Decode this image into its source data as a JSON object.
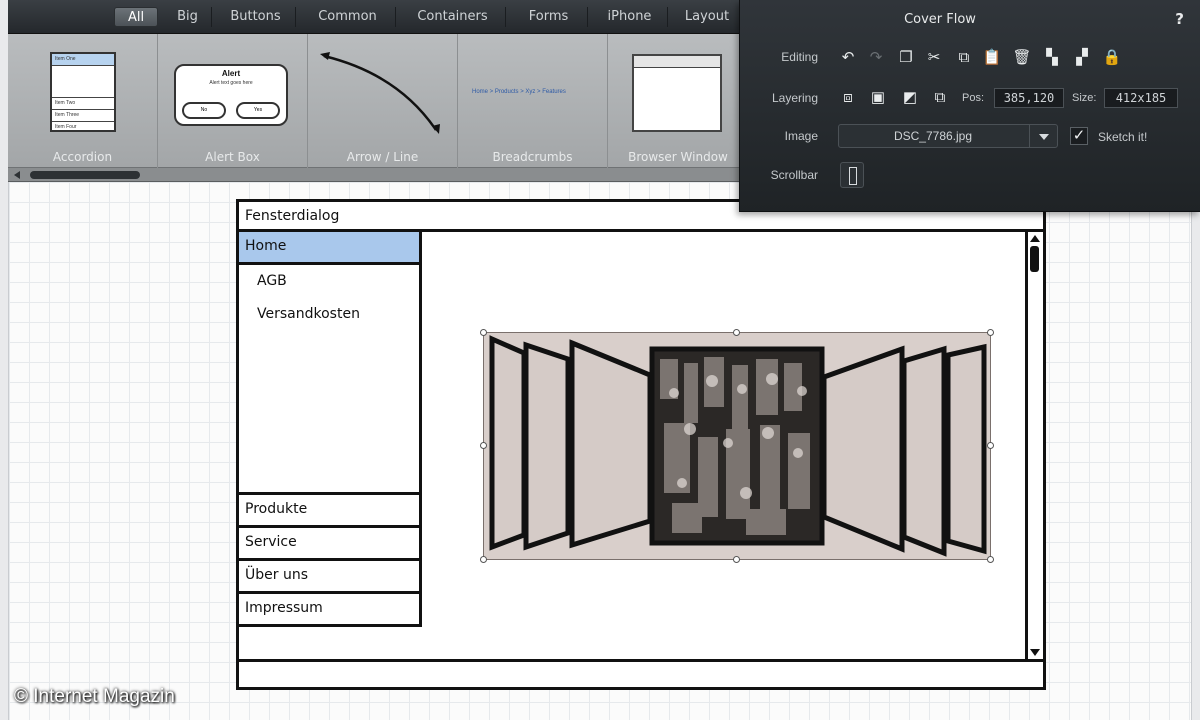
{
  "categories": {
    "tabs": [
      {
        "label": "All",
        "active": true
      },
      {
        "label": "Big"
      },
      {
        "label": "Buttons"
      },
      {
        "label": "Common"
      },
      {
        "label": "Containers"
      },
      {
        "label": "Forms"
      },
      {
        "label": "iPhone"
      },
      {
        "label": "Layout"
      }
    ]
  },
  "library": {
    "items": [
      {
        "label": "Accordion"
      },
      {
        "label": "Alert Box"
      },
      {
        "label": "Arrow / Line"
      },
      {
        "label": "Breadcrumbs"
      },
      {
        "label": "Browser Window"
      }
    ],
    "accordion_preview": [
      "Item One",
      "Item Two",
      "Item Three",
      "Item Four"
    ],
    "alert_preview": {
      "title": "Alert",
      "text": "Alert text goes here",
      "btn_no": "No",
      "btn_yes": "Yes"
    },
    "breadcrumb_preview": "Home > Products > Xyz > Features"
  },
  "inspector": {
    "title": "Cover Flow",
    "help": "?",
    "labels": {
      "editing": "Editing",
      "layering": "Layering",
      "image": "Image",
      "scrollbar": "Scrollbar"
    },
    "pos_label": "Pos:",
    "pos_value": "385,120",
    "size_label": "Size:",
    "size_value": "412x185",
    "image_file": "DSC_7786.jpg",
    "sketch_label": "Sketch it!",
    "sketch_checked": true,
    "icons": {
      "editing": [
        "undo-icon",
        "redo-icon",
        "duplicate-icon",
        "cut-icon",
        "copy-icon",
        "paste-icon",
        "delete-icon",
        "group-icon",
        "ungroup-icon",
        "lock-icon"
      ],
      "layering": [
        "bring-to-front-icon",
        "bring-forward-icon",
        "send-backward-icon",
        "send-to-back-icon"
      ]
    }
  },
  "mockup": {
    "window_title": "Fensterdialog",
    "nav_home": "Home",
    "nav_sub": [
      "AGB",
      "Versandkosten"
    ],
    "nav_items": [
      "Produkte",
      "Service",
      "Über uns",
      "Impressum"
    ]
  },
  "watermark": "© Internet Magazin",
  "colors": {
    "topbar": "#2d3236",
    "library_bg": "#aeb1b3",
    "inspector_bg": "#272b2f",
    "nav_highlight": "#a9c8ec",
    "coverflow_bg": "#d9cfcb"
  }
}
